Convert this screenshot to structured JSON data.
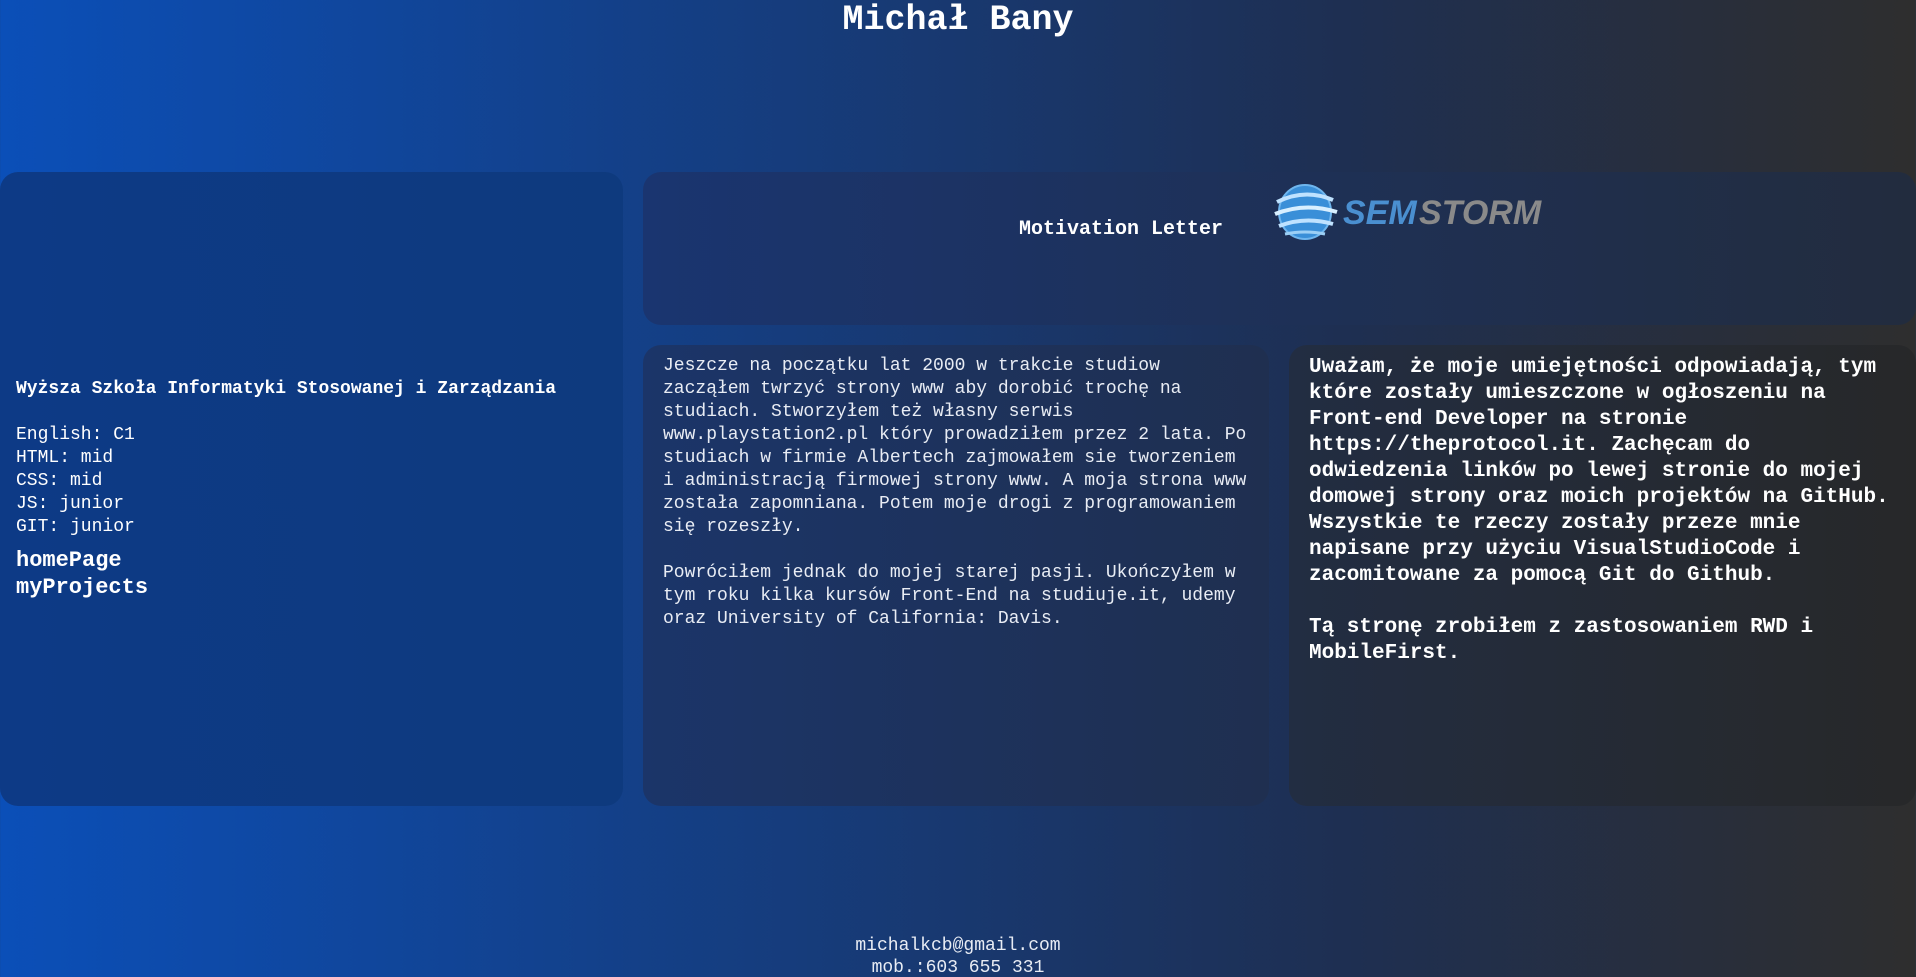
{
  "page": {
    "title": "Michał Bany"
  },
  "sidebar": {
    "school": "Wyższa Szkoła Informatyki Stosowanej i Zarządzania",
    "skills": [
      "English: C1",
      "HTML: mid",
      "CSS: mid",
      "JS: junior",
      "GIT: junior"
    ],
    "links": [
      "homePage",
      "myProjects"
    ]
  },
  "header": {
    "heading": "Motivation Letter",
    "logo_text_a": "SEM",
    "logo_text_b": "STORM"
  },
  "main": {
    "paragraphs": [
      "Jeszcze na początku lat 2000 w trakcie studiow zacząłem twrzyć strony www aby dorobić trochę na studiach. Stworzyłem też własny serwis www.playstation2.pl który prowadziłem przez 2 lata. Po studiach w firmie Albertech zajmowałem sie tworzeniem i administracją firmowej strony www. A moja strona www została zapomniana. Potem moje drogi z programowaniem się rozeszły.",
      "Powróciłem jednak do mojej starej pasji. Ukończyłem w tym roku kilka kursów Front-End na studiuje.it, udemy oraz University of California: Davis."
    ]
  },
  "aside": {
    "paragraphs": [
      "Uważam, że moje umiejętności odpowiadają, tym które zostały umieszczone w ogłoszeniu na Front-end Developer na stronie https://theprotocol.it. Zachęcam do odwiedzenia linków po lewej stronie do mojej domowej strony oraz moich projektów na GitHub. Wszystkie te rzeczy zostały przeze mnie napisane przy użyciu VisualStudioCode i zacomitowane za pomocą Git do Github.",
      "Tą stronę zrobiłem z zastosowaniem RWD i MobileFirst."
    ]
  },
  "footer": {
    "email": "michalkcb@gmail.com",
    "phone": "mob.:603 655 331"
  },
  "colors": {
    "background_left": "#0b4fb8",
    "background_right": "#2e2e2e",
    "logo_blue": "#3a8fd8",
    "logo_gray": "#8a8a8a"
  }
}
